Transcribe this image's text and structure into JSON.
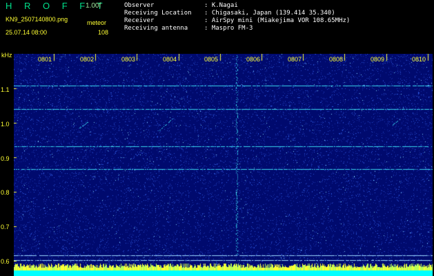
{
  "header": {
    "app_title": "H R O F F T",
    "version": "1.00f",
    "filename": "KN9_2507140800.png",
    "mode": "meteor",
    "datetime": "25.07.14 08:00",
    "count": "108"
  },
  "info": {
    "labels": "Observer\nReceiving Location\nReceiver\nReceiving antenna",
    "values": ": K.Nagai\n: Chigasaki, Japan (139.414 35.340)\n: AirSpy mini (Miakejima VOR 108.65MHz)\n: Maspro FM-3"
  },
  "spectrogram": {
    "unit_label": "kHz",
    "y_ticks": [
      "1.1",
      "1.0",
      "0.9",
      "0.8",
      "0.7",
      "0.6"
    ],
    "time_ticks": [
      "0801",
      "0802",
      "0803",
      "0804",
      "0805",
      "0806",
      "0807",
      "0808",
      "0809",
      "0810"
    ],
    "colors": {
      "background": "#000a6e",
      "noise": "#2a53d8",
      "signal": "#38d8f0",
      "tick": "#ffff33",
      "bottom_bar": "#00ffff"
    }
  }
}
